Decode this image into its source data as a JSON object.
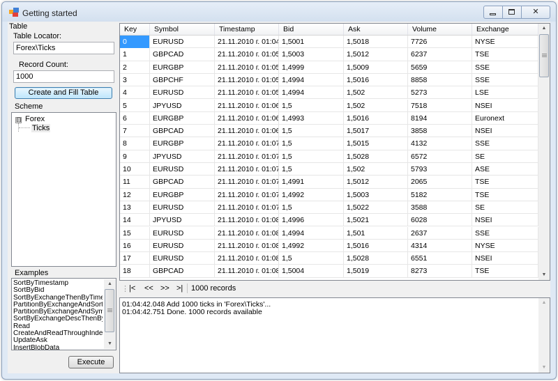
{
  "window": {
    "title": "Getting started"
  },
  "left_panel": {
    "table_group_label": "Table",
    "table_locator_label": "Table Locator:",
    "table_locator_value": "Forex\\Ticks",
    "record_count_label": "Record Count:",
    "record_count_value": "1000",
    "create_button": "Create and Fill Table",
    "scheme_label": "Scheme",
    "tree": {
      "root_expander": "⊟",
      "root": "Forex",
      "child": "Ticks"
    },
    "examples_label": "Examples",
    "examples": [
      "SortByTimestamp",
      "SortByBid",
      "SortByExchangeThenByTimesta",
      "PartitionByExchangeAndSortByT",
      "PartitionByExchangeAndSymbol/",
      "SortByExchangeDescThenByTir",
      "Read",
      "CreateAndReadThroughIndex",
      "UpdateAsk",
      "InsertBlobData"
    ],
    "execute_button": "Execute"
  },
  "grid": {
    "columns": [
      "Key",
      "Symbol",
      "Timestamp",
      "Bid",
      "Ask",
      "Volume",
      "Exchange"
    ],
    "rows": [
      [
        "0",
        "EURUSD",
        "21.11.2010 г. 01:04",
        "1,5001",
        "1,5018",
        "7726",
        "NYSE"
      ],
      [
        "1",
        "GBPCAD",
        "21.11.2010 г. 01:05",
        "1,5003",
        "1,5012",
        "6237",
        "TSE"
      ],
      [
        "2",
        "EURGBP",
        "21.11.2010 г. 01:05",
        "1,4999",
        "1,5009",
        "5659",
        "SSE"
      ],
      [
        "3",
        "GBPCHF",
        "21.11.2010 г. 01:05",
        "1,4994",
        "1,5016",
        "8858",
        "SSE"
      ],
      [
        "4",
        "EURUSD",
        "21.11.2010 г. 01:05",
        "1,4994",
        "1,502",
        "5273",
        "LSE"
      ],
      [
        "5",
        "JPYUSD",
        "21.11.2010 г. 01:06",
        "1,5",
        "1,502",
        "7518",
        "NSEI"
      ],
      [
        "6",
        "EURGBP",
        "21.11.2010 г. 01:06",
        "1,4993",
        "1,5016",
        "8194",
        "Euronext"
      ],
      [
        "7",
        "GBPCAD",
        "21.11.2010 г. 01:06",
        "1,5",
        "1,5017",
        "3858",
        "NSEI"
      ],
      [
        "8",
        "EURGBP",
        "21.11.2010 г. 01:07",
        "1,5",
        "1,5015",
        "4132",
        "SSE"
      ],
      [
        "9",
        "JPYUSD",
        "21.11.2010 г. 01:07",
        "1,5",
        "1,5028",
        "6572",
        "SE"
      ],
      [
        "10",
        "EURUSD",
        "21.11.2010 г. 01:07",
        "1,5",
        "1,502",
        "5793",
        "ASE"
      ],
      [
        "11",
        "GBPCAD",
        "21.11.2010 г. 01:07",
        "1,4991",
        "1,5012",
        "2065",
        "TSE"
      ],
      [
        "12",
        "EURGBP",
        "21.11.2010 г. 01:07",
        "1,4992",
        "1,5003",
        "5182",
        "TSE"
      ],
      [
        "13",
        "EURUSD",
        "21.11.2010 г. 01:07",
        "1,5",
        "1,5022",
        "3588",
        "SE"
      ],
      [
        "14",
        "JPYUSD",
        "21.11.2010 г. 01:08",
        "1,4996",
        "1,5021",
        "6028",
        "NSEI"
      ],
      [
        "15",
        "EURUSD",
        "21.11.2010 г. 01:08",
        "1,4994",
        "1,501",
        "2637",
        "SSE"
      ],
      [
        "16",
        "EURUSD",
        "21.11.2010 г. 01:08",
        "1,4992",
        "1,5016",
        "4314",
        "NYSE"
      ],
      [
        "17",
        "EURUSD",
        "21.11.2010 г. 01:08",
        "1,5",
        "1,5028",
        "6551",
        "NSEI"
      ],
      [
        "18",
        "GBPCAD",
        "21.11.2010 г. 01:08",
        "1,5004",
        "1,5019",
        "8273",
        "TSE"
      ]
    ],
    "selected_cell": {
      "row": 0,
      "column": 0
    }
  },
  "navigator": {
    "first": "|<",
    "prev": "<<",
    "next": ">>",
    "last": ">|",
    "record_info": "1000 records"
  },
  "log": {
    "lines": [
      "01:04:42.048  Add 1000 ticks in 'Forex\\Ticks'...",
      "01:04:42.751  Done. 1000 records available"
    ]
  },
  "colors": {
    "selection": "#3399ff",
    "window_frame": "#dfe9f5",
    "control_face": "#f0f0f0"
  },
  "icons": [
    "app-icon",
    "minimize-icon",
    "maximize-icon",
    "close-icon",
    "scroll-up-arrow-icon",
    "scroll-down-arrow-icon",
    "tree-collapse-icon"
  ]
}
